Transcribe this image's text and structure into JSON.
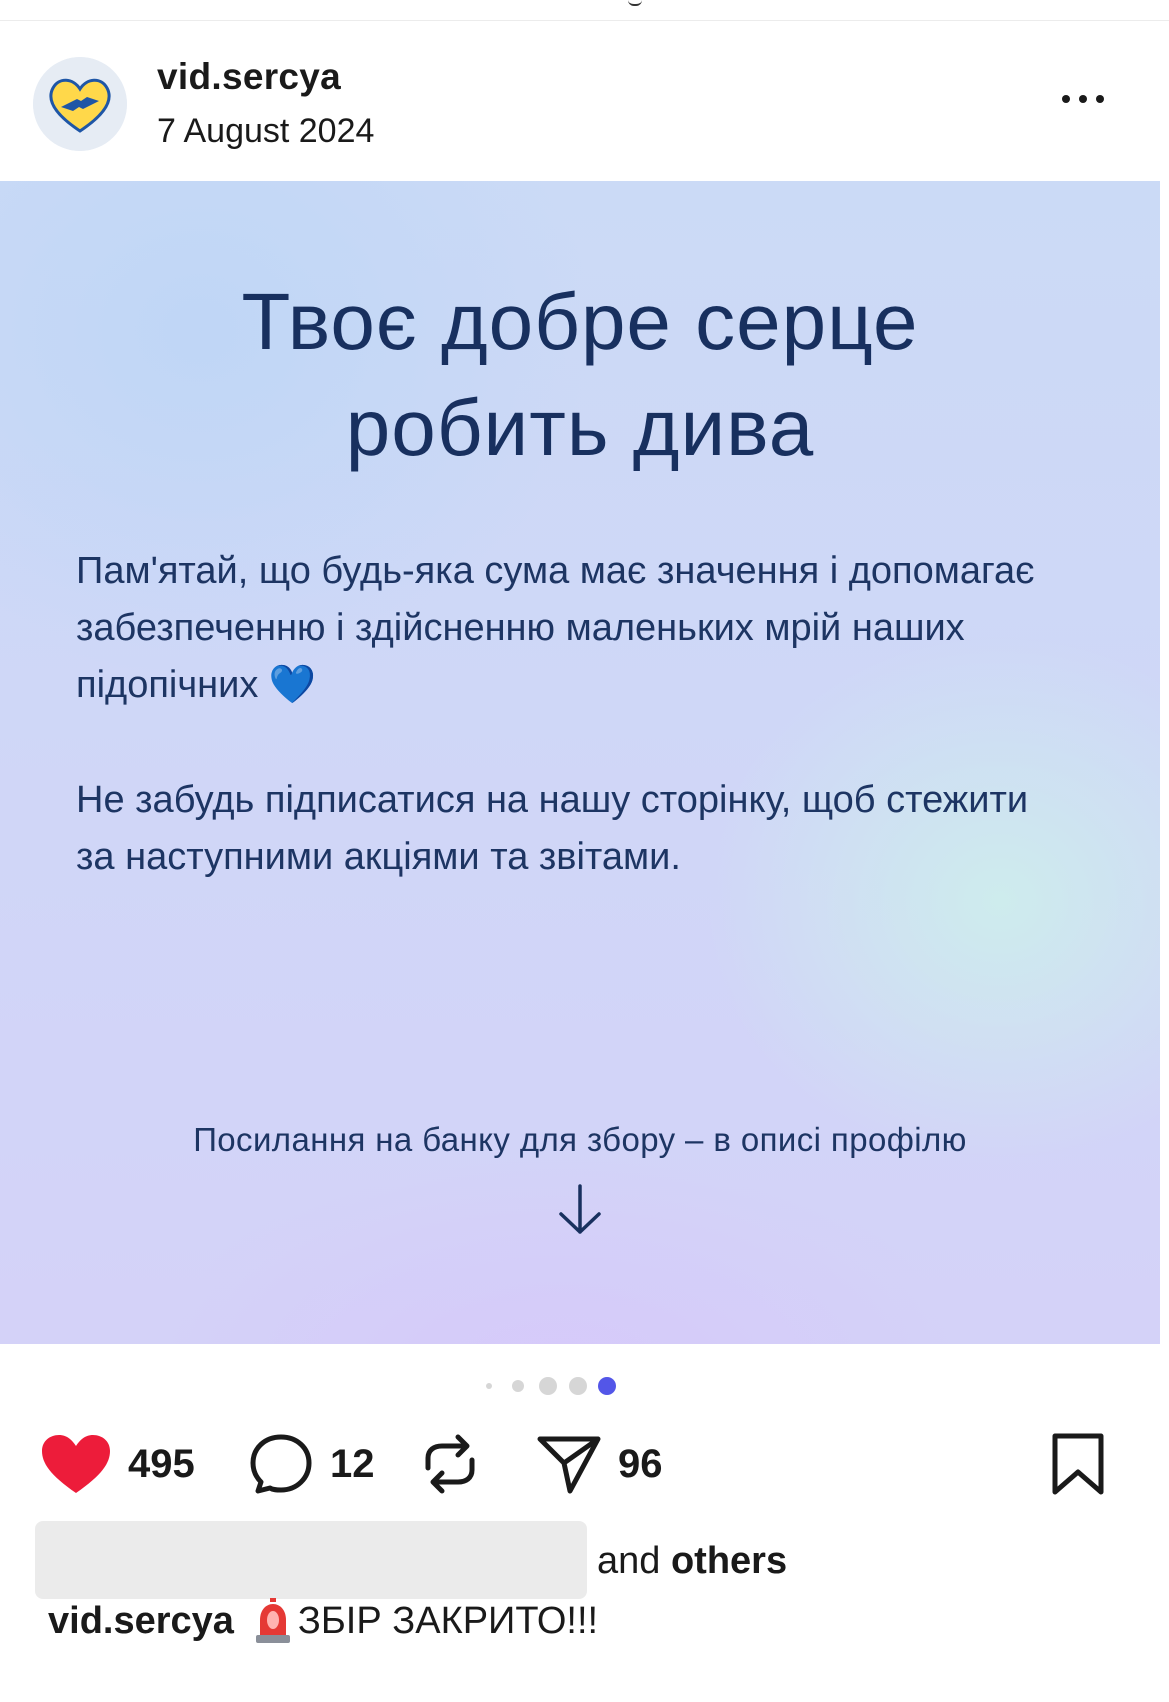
{
  "post": {
    "username": "vid.sercya",
    "date": "7 August 2024"
  },
  "image": {
    "headline_line1": "Твоє добре серце",
    "headline_line2": "робить дива",
    "paragraph1": "Пам'ятай, що будь-яка сума має значення і допомагає забезпеченню і здійсненню маленьких мрій наших підопічних 💙",
    "paragraph2": "Не забудь підписатися на нашу сторінку, щоб стежити за наступними акціями та звітами.",
    "bank_line": "Посилання на банку для збору – в описі профілю"
  },
  "carousel": {
    "total": 5,
    "active_index": 4
  },
  "actions": {
    "likes": "495",
    "comments": "12",
    "shares": "96"
  },
  "likes_line": {
    "and": "and",
    "others": "others"
  },
  "caption": {
    "username": "vid.sercya",
    "text": "ЗБІР ЗАКРИТО!!!"
  },
  "colors": {
    "heart": "#ed1c3a",
    "active_dot": "#5356e8",
    "headline": "#18305f"
  },
  "icons": [
    "heart-icon",
    "comment-icon",
    "repost-icon",
    "send-icon",
    "bookmark-icon",
    "more-icon",
    "down-arrow-icon",
    "siren-icon"
  ]
}
